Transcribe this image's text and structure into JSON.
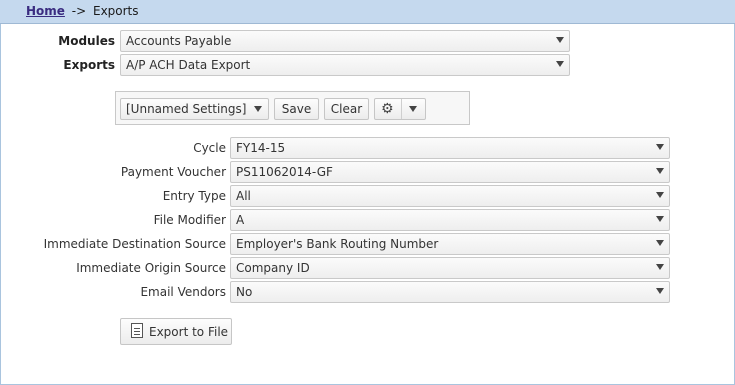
{
  "breadcrumb": {
    "home": "Home",
    "separator": "->",
    "current": "Exports"
  },
  "top_fields": {
    "modules": {
      "label": "Modules",
      "value": "Accounts Payable"
    },
    "exports": {
      "label": "Exports",
      "value": "A/P ACH Data Export"
    }
  },
  "settings_bar": {
    "selected": "[Unnamed Settings]",
    "save_label": "Save",
    "clear_label": "Clear",
    "gear_icon": "gear-icon"
  },
  "parameters": [
    {
      "label": "Cycle",
      "value": "FY14-15"
    },
    {
      "label": "Payment Voucher",
      "value": "PS11062014-GF"
    },
    {
      "label": "Entry Type",
      "value": "All"
    },
    {
      "label": "File Modifier",
      "value": "A"
    },
    {
      "label": "Immediate Destination Source",
      "value": "Employer's Bank Routing Number"
    },
    {
      "label": "Immediate Origin Source",
      "value": "Company ID"
    },
    {
      "label": "Email Vendors",
      "value": "No"
    }
  ],
  "export_button": {
    "label": "Export to File",
    "icon": "document-icon"
  },
  "colors": {
    "titlebar": "#c5d9ee",
    "link": "#3a2c80"
  }
}
